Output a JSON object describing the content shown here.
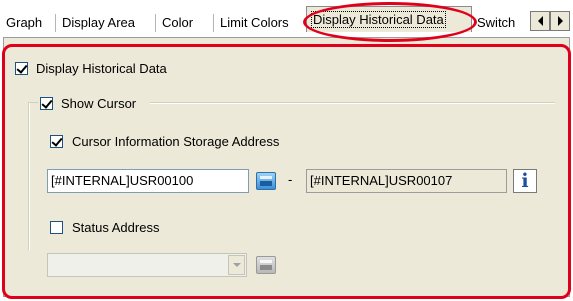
{
  "tabs": [
    {
      "label": "Graph"
    },
    {
      "label": "Display Area"
    },
    {
      "label": "Color"
    },
    {
      "label": "Limit Colors"
    },
    {
      "label": "Display Historical Data",
      "active": true
    },
    {
      "label": "Switch"
    }
  ],
  "panel": {
    "display_historical": {
      "label": "Display Historical Data",
      "checked": true
    },
    "show_cursor": {
      "label": "Show Cursor",
      "checked": true
    },
    "cursor_info": {
      "label": "Cursor Information Storage Address",
      "checked": true,
      "start_address": "[#INTERNAL]USR00100",
      "separator": "-",
      "end_address": "[#INTERNAL]USR00107",
      "info_glyph": "i"
    },
    "status_address": {
      "label": "Status Address",
      "checked": false,
      "value": ""
    }
  },
  "icons": {
    "address_picker": "address-picker-icon",
    "info": "info-icon",
    "scroll_left": "scroll-left-icon",
    "scroll_right": "scroll-right-icon",
    "dropdown": "chevron-down-icon"
  },
  "colors": {
    "panel_bg": "#ece9d8",
    "highlight": "#e0001b",
    "info_blue": "#1c4fa3"
  }
}
